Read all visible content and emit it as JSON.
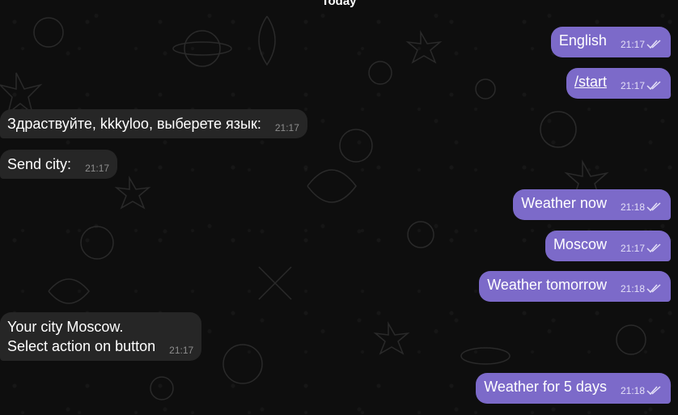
{
  "date_separator": "Today",
  "messages": [
    {
      "direction": "out",
      "text": "English",
      "time": "21:17"
    },
    {
      "direction": "out",
      "text": "/start",
      "time": "21:17"
    },
    {
      "direction": "in",
      "text": "Здраствуйте, kkkyloo, выберете язык:",
      "time": "21:17"
    },
    {
      "direction": "in",
      "text": "Send city:",
      "time": "21:17"
    },
    {
      "direction": "out",
      "text": "Weather now",
      "time": "21:18"
    },
    {
      "direction": "out",
      "text": "Moscow",
      "time": "21:17"
    },
    {
      "direction": "out",
      "text": "Weather tomorrow",
      "time": "21:18"
    },
    {
      "direction": "in",
      "text": "Your city Moscow.\nSelect action on button",
      "time": "21:17"
    },
    {
      "direction": "out",
      "text": "Weather for 5 days",
      "time": "21:18"
    }
  ],
  "colors": {
    "background": "#0e0e0e",
    "outgoing_bubble": "#7c6ac9",
    "incoming_bubble": "#262626",
    "text": "#ffffff"
  },
  "icons": {
    "read_receipt": "double-check-icon"
  }
}
